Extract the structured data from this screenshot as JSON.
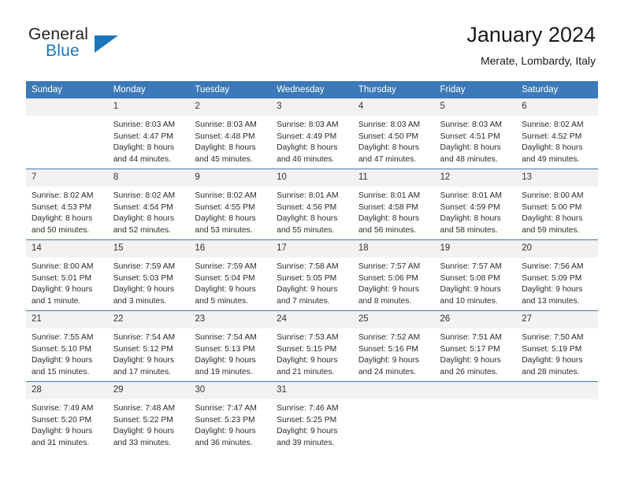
{
  "brand": {
    "name_part1": "General",
    "name_part2": "Blue",
    "logo_color": "#1b75bb",
    "text_color": "#231f20"
  },
  "header": {
    "month_title": "January 2024",
    "location": "Merate, Lombardy, Italy"
  },
  "theme": {
    "header_blue": "#3b79b8",
    "daynum_band": "#f2f2f2",
    "cell_bg": "#ffffff",
    "text": "#2b2b2b"
  },
  "weekday_headers": [
    "Sunday",
    "Monday",
    "Tuesday",
    "Wednesday",
    "Thursday",
    "Friday",
    "Saturday"
  ],
  "weeks": [
    [
      {
        "day": "",
        "sunrise": "",
        "sunset": "",
        "daylight_line1": "",
        "daylight_line2": ""
      },
      {
        "day": "1",
        "sunrise": "Sunrise: 8:03 AM",
        "sunset": "Sunset: 4:47 PM",
        "daylight_line1": "Daylight: 8 hours",
        "daylight_line2": "and 44 minutes."
      },
      {
        "day": "2",
        "sunrise": "Sunrise: 8:03 AM",
        "sunset": "Sunset: 4:48 PM",
        "daylight_line1": "Daylight: 8 hours",
        "daylight_line2": "and 45 minutes."
      },
      {
        "day": "3",
        "sunrise": "Sunrise: 8:03 AM",
        "sunset": "Sunset: 4:49 PM",
        "daylight_line1": "Daylight: 8 hours",
        "daylight_line2": "and 46 minutes."
      },
      {
        "day": "4",
        "sunrise": "Sunrise: 8:03 AM",
        "sunset": "Sunset: 4:50 PM",
        "daylight_line1": "Daylight: 8 hours",
        "daylight_line2": "and 47 minutes."
      },
      {
        "day": "5",
        "sunrise": "Sunrise: 8:03 AM",
        "sunset": "Sunset: 4:51 PM",
        "daylight_line1": "Daylight: 8 hours",
        "daylight_line2": "and 48 minutes."
      },
      {
        "day": "6",
        "sunrise": "Sunrise: 8:02 AM",
        "sunset": "Sunset: 4:52 PM",
        "daylight_line1": "Daylight: 8 hours",
        "daylight_line2": "and 49 minutes."
      }
    ],
    [
      {
        "day": "7",
        "sunrise": "Sunrise: 8:02 AM",
        "sunset": "Sunset: 4:53 PM",
        "daylight_line1": "Daylight: 8 hours",
        "daylight_line2": "and 50 minutes."
      },
      {
        "day": "8",
        "sunrise": "Sunrise: 8:02 AM",
        "sunset": "Sunset: 4:54 PM",
        "daylight_line1": "Daylight: 8 hours",
        "daylight_line2": "and 52 minutes."
      },
      {
        "day": "9",
        "sunrise": "Sunrise: 8:02 AM",
        "sunset": "Sunset: 4:55 PM",
        "daylight_line1": "Daylight: 8 hours",
        "daylight_line2": "and 53 minutes."
      },
      {
        "day": "10",
        "sunrise": "Sunrise: 8:01 AM",
        "sunset": "Sunset: 4:56 PM",
        "daylight_line1": "Daylight: 8 hours",
        "daylight_line2": "and 55 minutes."
      },
      {
        "day": "11",
        "sunrise": "Sunrise: 8:01 AM",
        "sunset": "Sunset: 4:58 PM",
        "daylight_line1": "Daylight: 8 hours",
        "daylight_line2": "and 56 minutes."
      },
      {
        "day": "12",
        "sunrise": "Sunrise: 8:01 AM",
        "sunset": "Sunset: 4:59 PM",
        "daylight_line1": "Daylight: 8 hours",
        "daylight_line2": "and 58 minutes."
      },
      {
        "day": "13",
        "sunrise": "Sunrise: 8:00 AM",
        "sunset": "Sunset: 5:00 PM",
        "daylight_line1": "Daylight: 8 hours",
        "daylight_line2": "and 59 minutes."
      }
    ],
    [
      {
        "day": "14",
        "sunrise": "Sunrise: 8:00 AM",
        "sunset": "Sunset: 5:01 PM",
        "daylight_line1": "Daylight: 9 hours",
        "daylight_line2": "and 1 minute."
      },
      {
        "day": "15",
        "sunrise": "Sunrise: 7:59 AM",
        "sunset": "Sunset: 5:03 PM",
        "daylight_line1": "Daylight: 9 hours",
        "daylight_line2": "and 3 minutes."
      },
      {
        "day": "16",
        "sunrise": "Sunrise: 7:59 AM",
        "sunset": "Sunset: 5:04 PM",
        "daylight_line1": "Daylight: 9 hours",
        "daylight_line2": "and 5 minutes."
      },
      {
        "day": "17",
        "sunrise": "Sunrise: 7:58 AM",
        "sunset": "Sunset: 5:05 PM",
        "daylight_line1": "Daylight: 9 hours",
        "daylight_line2": "and 7 minutes."
      },
      {
        "day": "18",
        "sunrise": "Sunrise: 7:57 AM",
        "sunset": "Sunset: 5:06 PM",
        "daylight_line1": "Daylight: 9 hours",
        "daylight_line2": "and 8 minutes."
      },
      {
        "day": "19",
        "sunrise": "Sunrise: 7:57 AM",
        "sunset": "Sunset: 5:08 PM",
        "daylight_line1": "Daylight: 9 hours",
        "daylight_line2": "and 10 minutes."
      },
      {
        "day": "20",
        "sunrise": "Sunrise: 7:56 AM",
        "sunset": "Sunset: 5:09 PM",
        "daylight_line1": "Daylight: 9 hours",
        "daylight_line2": "and 13 minutes."
      }
    ],
    [
      {
        "day": "21",
        "sunrise": "Sunrise: 7:55 AM",
        "sunset": "Sunset: 5:10 PM",
        "daylight_line1": "Daylight: 9 hours",
        "daylight_line2": "and 15 minutes."
      },
      {
        "day": "22",
        "sunrise": "Sunrise: 7:54 AM",
        "sunset": "Sunset: 5:12 PM",
        "daylight_line1": "Daylight: 9 hours",
        "daylight_line2": "and 17 minutes."
      },
      {
        "day": "23",
        "sunrise": "Sunrise: 7:54 AM",
        "sunset": "Sunset: 5:13 PM",
        "daylight_line1": "Daylight: 9 hours",
        "daylight_line2": "and 19 minutes."
      },
      {
        "day": "24",
        "sunrise": "Sunrise: 7:53 AM",
        "sunset": "Sunset: 5:15 PM",
        "daylight_line1": "Daylight: 9 hours",
        "daylight_line2": "and 21 minutes."
      },
      {
        "day": "25",
        "sunrise": "Sunrise: 7:52 AM",
        "sunset": "Sunset: 5:16 PM",
        "daylight_line1": "Daylight: 9 hours",
        "daylight_line2": "and 24 minutes."
      },
      {
        "day": "26",
        "sunrise": "Sunrise: 7:51 AM",
        "sunset": "Sunset: 5:17 PM",
        "daylight_line1": "Daylight: 9 hours",
        "daylight_line2": "and 26 minutes."
      },
      {
        "day": "27",
        "sunrise": "Sunrise: 7:50 AM",
        "sunset": "Sunset: 5:19 PM",
        "daylight_line1": "Daylight: 9 hours",
        "daylight_line2": "and 28 minutes."
      }
    ],
    [
      {
        "day": "28",
        "sunrise": "Sunrise: 7:49 AM",
        "sunset": "Sunset: 5:20 PM",
        "daylight_line1": "Daylight: 9 hours",
        "daylight_line2": "and 31 minutes."
      },
      {
        "day": "29",
        "sunrise": "Sunrise: 7:48 AM",
        "sunset": "Sunset: 5:22 PM",
        "daylight_line1": "Daylight: 9 hours",
        "daylight_line2": "and 33 minutes."
      },
      {
        "day": "30",
        "sunrise": "Sunrise: 7:47 AM",
        "sunset": "Sunset: 5:23 PM",
        "daylight_line1": "Daylight: 9 hours",
        "daylight_line2": "and 36 minutes."
      },
      {
        "day": "31",
        "sunrise": "Sunrise: 7:46 AM",
        "sunset": "Sunset: 5:25 PM",
        "daylight_line1": "Daylight: 9 hours",
        "daylight_line2": "and 39 minutes."
      },
      {
        "day": "",
        "sunrise": "",
        "sunset": "",
        "daylight_line1": "",
        "daylight_line2": ""
      },
      {
        "day": "",
        "sunrise": "",
        "sunset": "",
        "daylight_line1": "",
        "daylight_line2": ""
      },
      {
        "day": "",
        "sunrise": "",
        "sunset": "",
        "daylight_line1": "",
        "daylight_line2": ""
      }
    ]
  ]
}
